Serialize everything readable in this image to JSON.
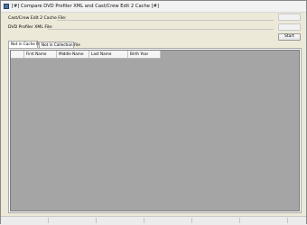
{
  "window": {
    "title": "[#] Compare DVD Profiler XML and Cast/Crew Edit 2 Cache [#]"
  },
  "fields": {
    "cache_label": "Cast/Crew Edit 2 Cache File:",
    "xml_label": "DVD Profiler XML File:"
  },
  "buttons": {
    "start_label": "Start"
  },
  "tabs": [
    {
      "label": "Not in Cache File",
      "active": true
    },
    {
      "label": "Not in Collection File",
      "active": false
    }
  ],
  "grid": {
    "columns": [
      "First Name",
      "Middle Name",
      "Last Name",
      "Birth Year"
    ]
  }
}
